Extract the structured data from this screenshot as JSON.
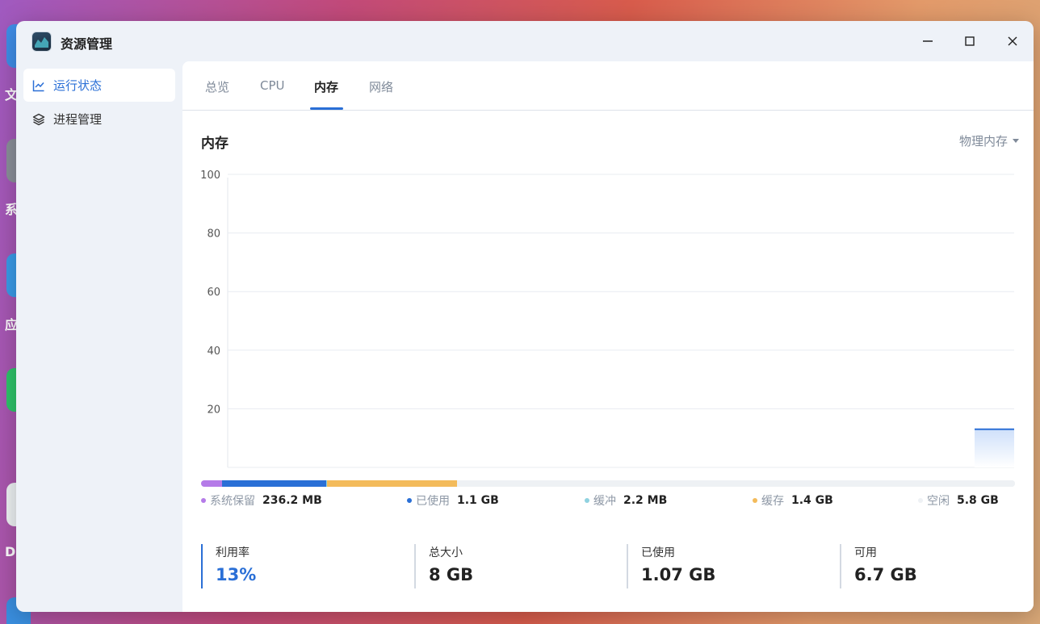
{
  "app": {
    "title": "资源管理"
  },
  "desktop": {
    "labels": [
      "文",
      "系",
      "应",
      "D"
    ]
  },
  "sidebar": {
    "items": [
      {
        "label": "运行状态",
        "icon": "line-chart-icon",
        "active": true
      },
      {
        "label": "进程管理",
        "icon": "layers-icon",
        "active": false
      }
    ]
  },
  "tabs": [
    {
      "label": "总览",
      "active": false
    },
    {
      "label": "CPU",
      "active": false
    },
    {
      "label": "内存",
      "active": true
    },
    {
      "label": "网络",
      "active": false
    }
  ],
  "section": {
    "title": "内存",
    "selector": "物理内存"
  },
  "chart_data": {
    "type": "area",
    "title": "",
    "ylim": [
      0,
      100
    ],
    "yticks": [
      20,
      40,
      60,
      80,
      100
    ],
    "grid": true,
    "series": [
      {
        "values": [
          13
        ]
      }
    ]
  },
  "usage_bar": [
    {
      "fraction": 0.026,
      "color": "#b57be8"
    },
    {
      "fraction": 0.128,
      "color": "#2a6fd6"
    },
    {
      "fraction": 0.0003,
      "color": "#8fd2e0"
    },
    {
      "fraction": 0.16,
      "color": "#f3bb5b"
    },
    {
      "fraction": 0.6857,
      "color": "#eef1f4"
    }
  ],
  "legend": [
    {
      "name": "系统保留",
      "value": "236.2 MB",
      "color": "#b57be8"
    },
    {
      "name": "已使用",
      "value": "1.1 GB",
      "color": "#2a6fd6"
    },
    {
      "name": "缓冲",
      "value": "2.2 MB",
      "color": "#8fd2e0"
    },
    {
      "name": "缓存",
      "value": "1.4 GB",
      "color": "#f3bb5b"
    },
    {
      "name": "空闲",
      "value": "5.8 GB",
      "color": "#eef1f4"
    }
  ],
  "stats": [
    {
      "label": "利用率",
      "value": "13%",
      "active": true
    },
    {
      "label": "总大小",
      "value": "8 GB",
      "active": false
    },
    {
      "label": "已使用",
      "value": "1.07 GB",
      "active": false
    },
    {
      "label": "可用",
      "value": "6.7 GB",
      "active": false
    }
  ]
}
